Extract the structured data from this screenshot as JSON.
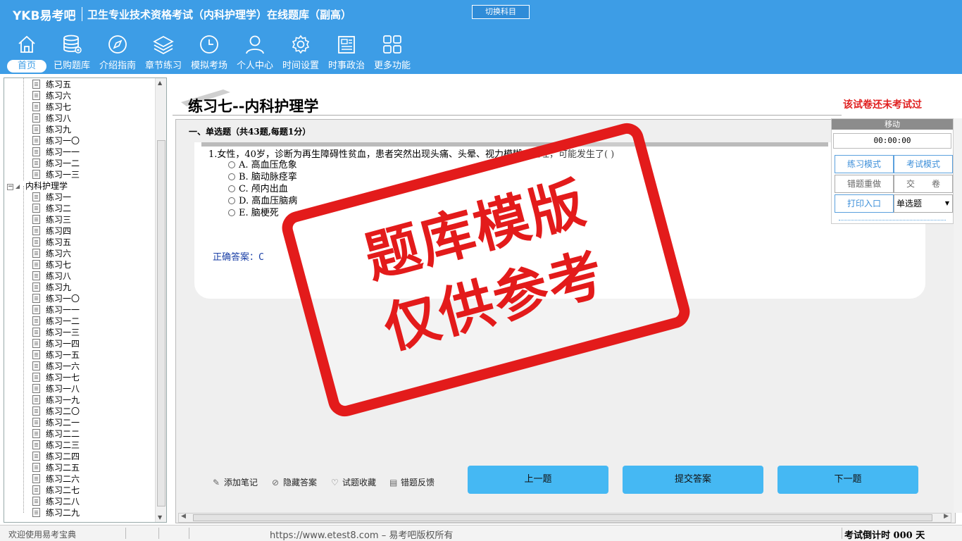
{
  "header": {
    "brand": "YKB易考吧",
    "app_title": "卫生专业技术资格考试（内科护理学）在线题库（副高）",
    "switch_label": "切换科目",
    "nav": [
      {
        "label": "首页",
        "icon": "home-icon"
      },
      {
        "label": "已购题库",
        "icon": "database-icon"
      },
      {
        "label": "介绍指南",
        "icon": "compass-icon"
      },
      {
        "label": "章节练习",
        "icon": "layers-icon"
      },
      {
        "label": "模拟考场",
        "icon": "clock-icon"
      },
      {
        "label": "个人中心",
        "icon": "user-icon"
      },
      {
        "label": "时间设置",
        "icon": "gear-icon"
      },
      {
        "label": "时事政治",
        "icon": "newspaper-icon"
      },
      {
        "label": "更多功能",
        "icon": "grid-icon"
      }
    ]
  },
  "tree": {
    "top_items": [
      "练习五",
      "练习六",
      "练习七",
      "练习八",
      "练习九",
      "练习一〇",
      "练习一一",
      "练习一二",
      "练习一三"
    ],
    "folder": "内科护理学",
    "folder_items": [
      "练习一",
      "练习二",
      "练习三",
      "练习四",
      "练习五",
      "练习六",
      "练习七",
      "练习八",
      "练习九",
      "练习一〇",
      "练习一一",
      "练习一二",
      "练习一三",
      "练习一四",
      "练习一五",
      "练习一六",
      "练习一七",
      "练习一八",
      "练习一九",
      "练习二〇",
      "练习二一",
      "练习二二",
      "练习二三",
      "练习二四",
      "练习二五",
      "练习二六",
      "练习二七",
      "练习二八",
      "练习二九"
    ]
  },
  "paper": {
    "title": "练习七--内科护理学",
    "status": "该试卷还未考试过"
  },
  "question": {
    "section": "一、单选题（共43题,每题1分）",
    "text": "1.女性，40岁，诊断为再生障碍性贫血，患者突然出现头痛、头晕、视力模糊、呕吐，可能发生了( )",
    "options": [
      "A. 高血压危象",
      "B. 脑动脉痉挛",
      "C. 颅内出血",
      "D. 高血压脑病",
      "E. 脑梗死"
    ],
    "answer": "正确答案：C"
  },
  "tools": {
    "note": "添加笔记",
    "hide_answer": "隐藏答案",
    "favorite": "试题收藏",
    "feedback": "错题反馈",
    "prev": "上一题",
    "submit": "提交答案",
    "next": "下一题"
  },
  "panel": {
    "head": "移动",
    "timer": "00:00:00",
    "practice_mode": "练习模式",
    "exam_mode": "考试模式",
    "redo_wrong": "错题重做",
    "hand_in": "交　　卷",
    "print": "打印入口",
    "qtype": "单选题"
  },
  "status": {
    "left": "欢迎使用易考宝典",
    "center": "https://www.etest8.com – 易考吧版权所有",
    "right": "考试倒计时 000 天"
  },
  "watermark": {
    "line1": "题库模版",
    "line2": "仅供参考"
  },
  "colors": {
    "header": "#3d9de6",
    "accent_button": "#45b8f3",
    "status_red": "#e02020",
    "stamp_red": "#e31b1b",
    "answer_blue": "#1a3fa6"
  }
}
